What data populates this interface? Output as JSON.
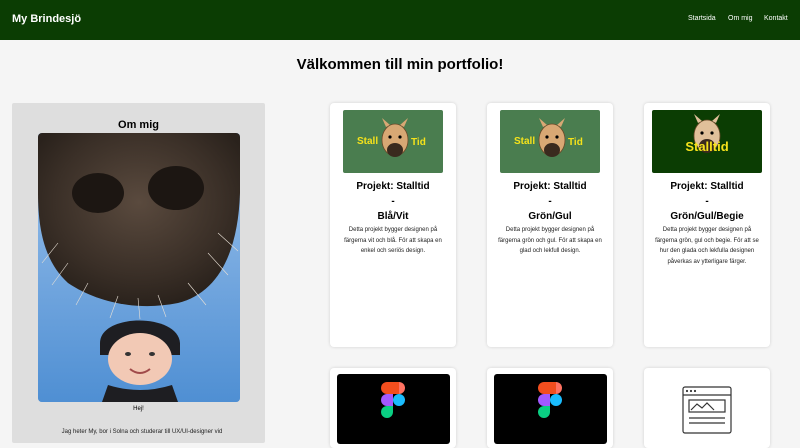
{
  "nav": {
    "brand": "My Brindesjö",
    "links": [
      "Startsida",
      "Om mig",
      "Kontakt"
    ]
  },
  "page": {
    "heading": "Välkommen till min portfolio!"
  },
  "about": {
    "title": "Om mig",
    "greeting": "Hej!",
    "bio": "Jag heter My, bor i Solna och studerar till UX/UI-designer vid"
  },
  "logo_text": {
    "stall": "Stall",
    "tid": "Tid",
    "stalltid": "Stalltid"
  },
  "projects": [
    {
      "title": "Projekt: Stalltid",
      "dash": "-",
      "subtitle": "Blå/Vit",
      "description": "Detta projekt bygger designen på färgerna vit och blå. För att skapa en enkel och seriös design."
    },
    {
      "title": "Projekt: Stalltid",
      "dash": "-",
      "subtitle": "Grön/Gul",
      "description": "Detta projekt bygger designen på färgerna grön och gul. För att skapa en glad och lekfull design."
    },
    {
      "title": "Projekt: Stalltid",
      "dash": "-",
      "subtitle": "Grön/Gul/Begie",
      "description": "Detta projekt bygger designen på färgerna grön, gul och begie. För att se hur den glada och lekfulla designen påverkas av ytterligare färger."
    }
  ],
  "colors": {
    "nav_bg": "#0b3d03",
    "logo_green_light": "#4a7d4f",
    "logo_green_dark": "#0b3d03",
    "logo_yellow": "#f5e21b",
    "about_bg": "#dedede",
    "figma_red": "#f24e1e",
    "figma_orange": "#ff7262",
    "figma_purple": "#a259ff",
    "figma_blue": "#1abcfe",
    "figma_green": "#0acf83"
  },
  "icons": [
    "horse-head-icon",
    "figma-icon",
    "website-wireframe-icon"
  ]
}
